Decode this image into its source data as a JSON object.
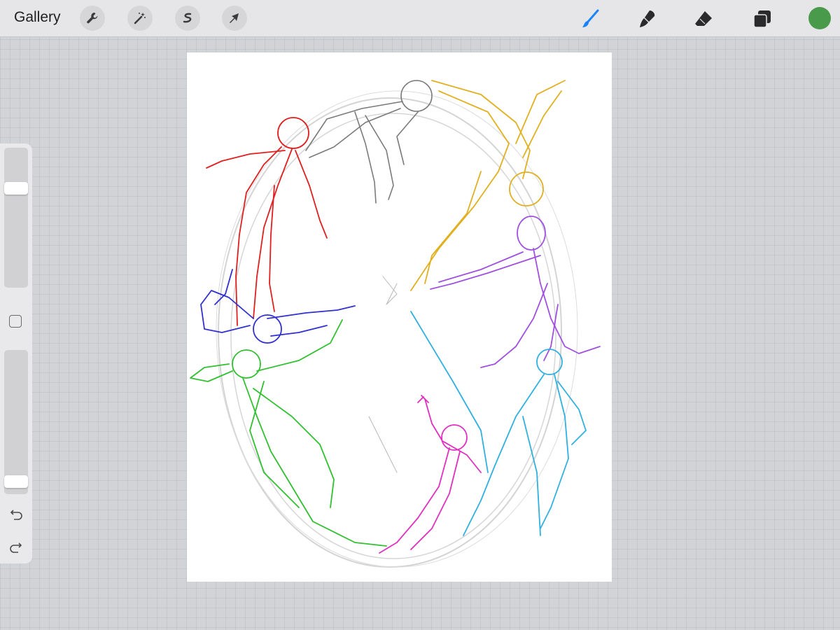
{
  "toolbar": {
    "gallery_label": "Gallery",
    "left_tools": [
      "wrench-icon",
      "magic-wand-icon",
      "selection-icon",
      "transform-arrow-icon"
    ],
    "right_tools": [
      "brush-icon",
      "smudge-icon",
      "eraser-icon",
      "layers-icon"
    ],
    "active_tool": "brush-icon",
    "active_color": "#4a9a4c",
    "accent_color": "#1a84ff"
  },
  "sidebar": {
    "brush_size_level": 0.73,
    "opacity_level": 0.05,
    "modify_button": "square-icon",
    "undo": "undo-icon",
    "redo": "redo-icon"
  },
  "canvas": {
    "background": "#ffffff",
    "sketch_colors": [
      "#e02020",
      "#7a7a7a",
      "#e0b020",
      "#a050e0",
      "#3030d0",
      "#30c030",
      "#e030c0",
      "#30b0e0"
    ]
  }
}
